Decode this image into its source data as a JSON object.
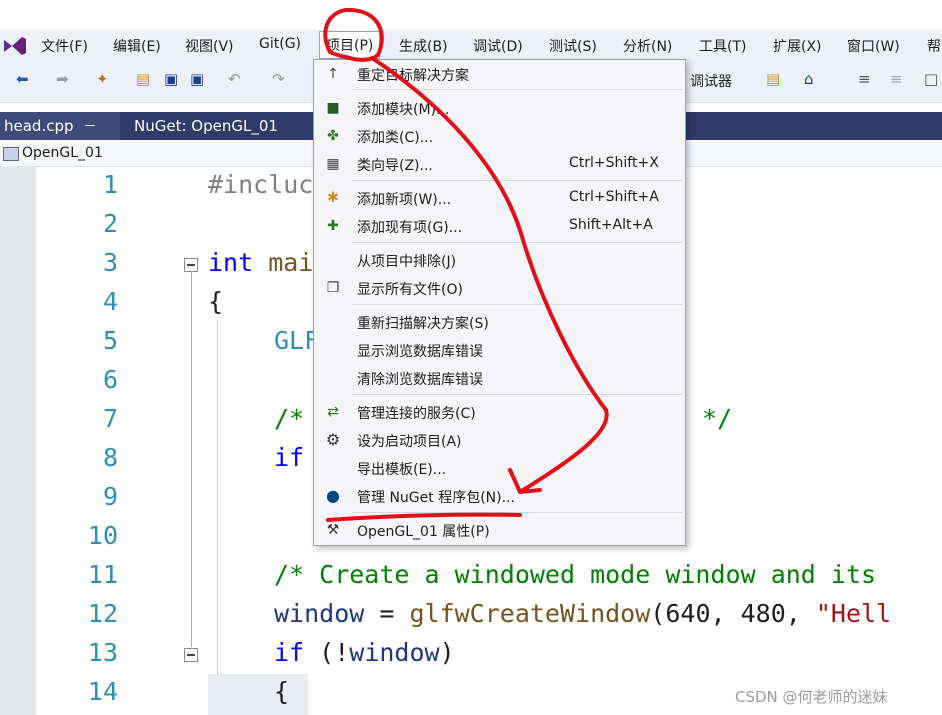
{
  "menubar": {
    "items": [
      "文件(F)",
      "编辑(E)",
      "视图(V)",
      "Git(G)",
      "项目(P)",
      "生成(B)",
      "调试(D)",
      "测试(S)",
      "分析(N)",
      "工具(T)",
      "扩展(X)",
      "窗口(W)",
      "帮"
    ]
  },
  "toolbar": {
    "debugger_label": "调试器"
  },
  "tabs": [
    "head.cpp",
    "NuGet: OpenGL_01"
  ],
  "tab_pin": "ㄧ",
  "navbar": {
    "project": "OpenGL_01"
  },
  "editor": {
    "line_numbers": [
      "1",
      "2",
      "3",
      "4",
      "5",
      "6",
      "7",
      "8",
      "9",
      "10",
      "11",
      "12",
      "13",
      "14"
    ],
    "l1": "#incluc",
    "l3_kw": "int",
    "l3_rest": " mai",
    "l4": "{",
    "l5": "GLF",
    "l7_a": "/*",
    "l7_b": "*/",
    "l8": "if",
    "l11": "/* Create a windowed mode window and its",
    "l12_id": "window",
    "l12_eq": " = ",
    "l12_fn": "glfwCreateWindow",
    "l12_args": "(640, 480, ",
    "l12_str": "\"Hell",
    "l13_kw": "if",
    "l13_paren": " (!",
    "l13_id": "window",
    "l13_close": ")",
    "l14": "{"
  },
  "project_menu": {
    "items": [
      {
        "label": "重定目标解决方案",
        "shortcut": "",
        "icon": "retarget-icon"
      },
      {
        "label": "添加模块(M)...",
        "shortcut": "",
        "icon": "add-module-icon"
      },
      {
        "label": "添加类(C)...",
        "shortcut": "",
        "icon": "add-class-icon"
      },
      {
        "label": "类向导(Z)...",
        "shortcut": "Ctrl+Shift+X",
        "icon": "class-wizard-icon"
      },
      {
        "label": "添加新项(W)...",
        "shortcut": "Ctrl+Shift+A",
        "icon": "add-new-item-icon"
      },
      {
        "label": "添加现有项(G)...",
        "shortcut": "Shift+Alt+A",
        "icon": "add-existing-item-icon"
      },
      {
        "label": "从项目中排除(J)",
        "shortcut": "",
        "icon": ""
      },
      {
        "label": "显示所有文件(O)",
        "shortcut": "",
        "icon": "show-all-files-icon"
      },
      {
        "label": "重新扫描解决方案(S)",
        "shortcut": "",
        "icon": ""
      },
      {
        "label": "显示浏览数据库错误",
        "shortcut": "",
        "icon": ""
      },
      {
        "label": "清除浏览数据库错误",
        "shortcut": "",
        "icon": ""
      },
      {
        "label": "管理连接的服务(C)",
        "shortcut": "",
        "icon": "connected-services-icon"
      },
      {
        "label": "设为启动项目(A)",
        "shortcut": "",
        "icon": "gear-icon"
      },
      {
        "label": "导出模板(E)...",
        "shortcut": "",
        "icon": ""
      },
      {
        "label": "管理 NuGet 程序包(N)...",
        "shortcut": "",
        "icon": "nuget-icon"
      },
      {
        "label": "OpenGL_01 属性(P)",
        "shortcut": "",
        "icon": "wrench-icon"
      }
    ]
  },
  "watermark": "CSDN @何老师的迷妹",
  "colors": {
    "accent": "#2f3b6a",
    "annotation": "#e0101a",
    "keyword": "#0000ff",
    "comment": "#008000"
  }
}
